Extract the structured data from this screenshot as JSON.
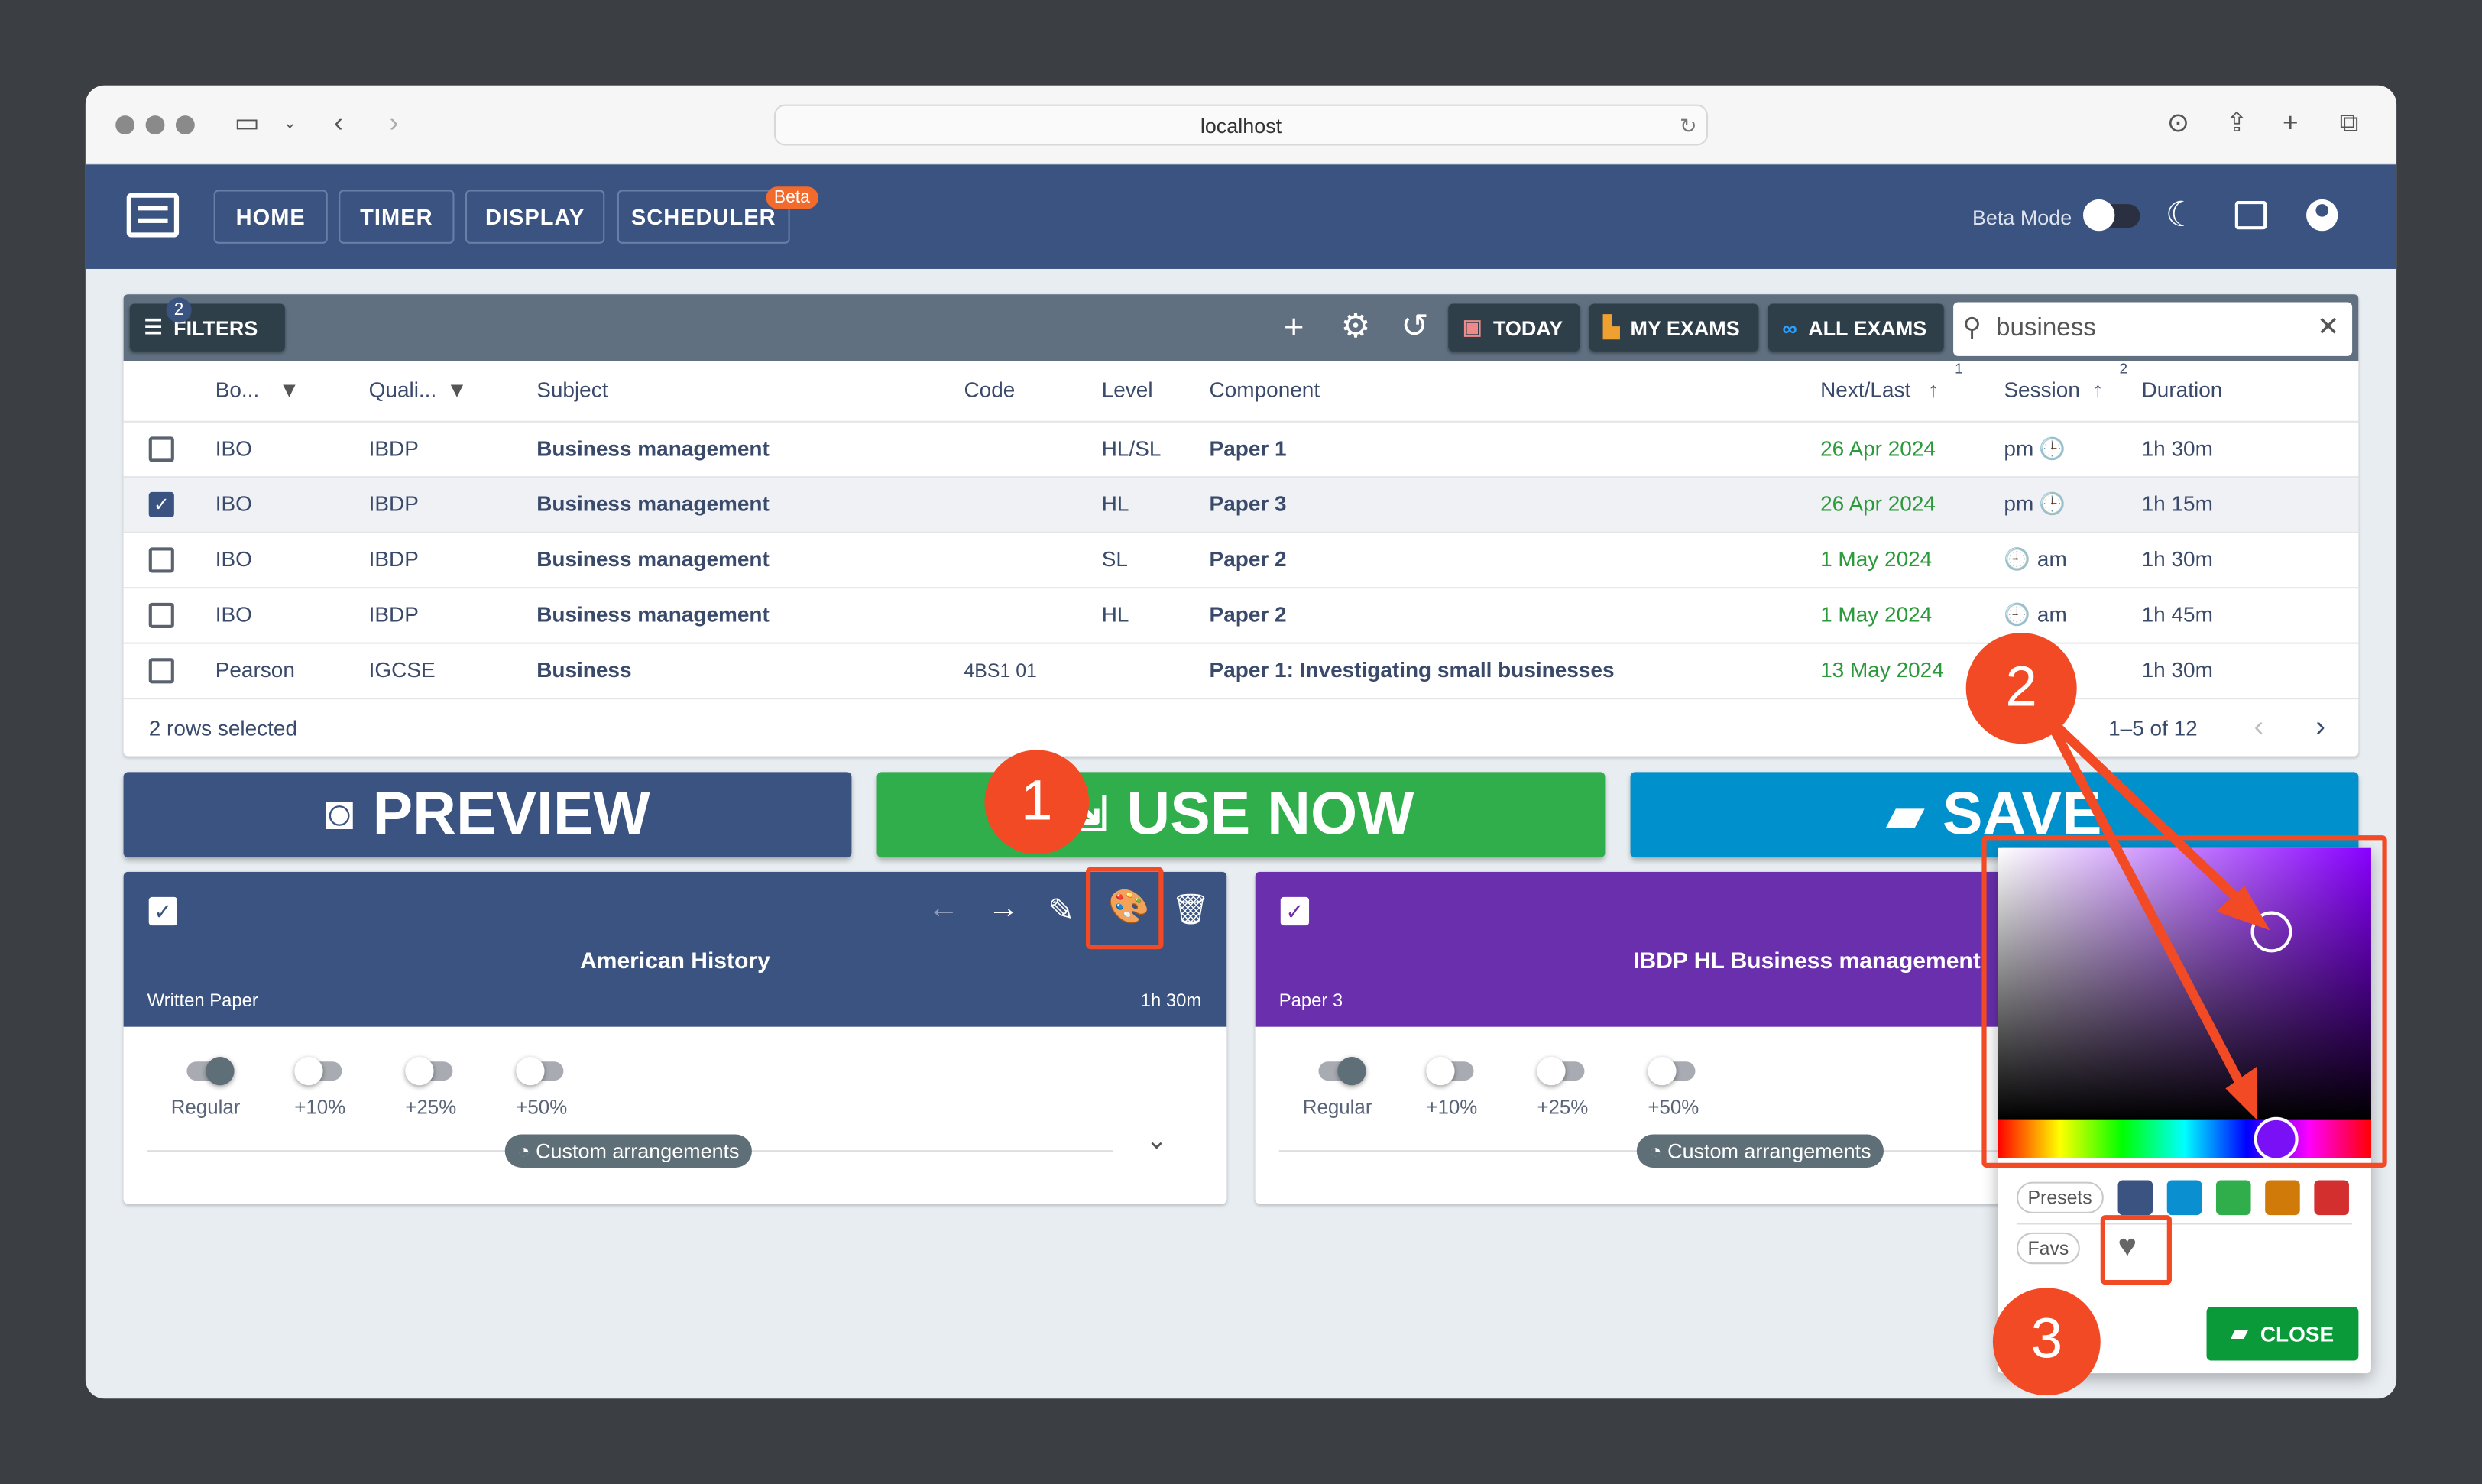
{
  "browser": {
    "url": "localhost"
  },
  "nav": {
    "items": [
      "HOME",
      "TIMER",
      "DISPLAY",
      "SCHEDULER"
    ],
    "beta_badge": "Beta",
    "beta_mode_label": "Beta Mode",
    "beta_mode_on": false
  },
  "toolbar": {
    "filters_label": "FILTERS",
    "filters_count": "2",
    "today": "TODAY",
    "my_exams": "MY EXAMS",
    "all_exams": "ALL EXAMS",
    "search_value": "business"
  },
  "table": {
    "columns": [
      "Bo...",
      "Quali...",
      "Subject",
      "Code",
      "Level",
      "Component",
      "Next/Last",
      "Session",
      "Duration"
    ],
    "sort_indices": {
      "next_last": "1",
      "session": "2"
    },
    "rows": [
      {
        "checked": false,
        "board": "IBO",
        "qual": "IBDP",
        "subject": "Business management",
        "code": "",
        "level": "HL/SL",
        "component": "Paper 1",
        "date": "26 Apr 2024",
        "session": "pm",
        "duration": "1h 30m"
      },
      {
        "checked": true,
        "board": "IBO",
        "qual": "IBDP",
        "subject": "Business management",
        "code": "",
        "level": "HL",
        "component": "Paper 3",
        "date": "26 Apr 2024",
        "session": "pm",
        "duration": "1h 15m"
      },
      {
        "checked": false,
        "board": "IBO",
        "qual": "IBDP",
        "subject": "Business management",
        "code": "",
        "level": "SL",
        "component": "Paper 2",
        "date": "1 May 2024",
        "session": "am",
        "duration": "1h 30m"
      },
      {
        "checked": false,
        "board": "IBO",
        "qual": "IBDP",
        "subject": "Business management",
        "code": "",
        "level": "HL",
        "component": "Paper 2",
        "date": "1 May 2024",
        "session": "am",
        "duration": "1h 45m"
      },
      {
        "checked": false,
        "board": "Pearson",
        "qual": "IGCSE",
        "subject": "Business",
        "code": "4BS1 01",
        "level": "",
        "component": "Paper 1: Investigating small businesses",
        "date": "13 May 2024",
        "session": "",
        "duration": "1h 30m"
      }
    ],
    "selected_text": "2 rows selected",
    "pagination": "1–5 of 12"
  },
  "actions": {
    "preview": "PREVIEW",
    "use_now": "USE NOW",
    "save": "SAVE"
  },
  "exam_cards": [
    {
      "title": "American History",
      "subtitle": "Written Paper",
      "duration": "1h 30m",
      "color": "#3a5380"
    },
    {
      "title": "IBDP HL Business management",
      "subtitle": "Paper 3",
      "duration": "",
      "color": "#6a2fad"
    }
  ],
  "extra_time": {
    "options": [
      "Regular",
      "+10%",
      "+25%",
      "+50%"
    ],
    "selected": "Regular",
    "custom_label": "Custom arrangements"
  },
  "color_picker": {
    "hue_degrees": 272,
    "presets_label": "Presets",
    "presets": [
      "#3a5380",
      "#0a90d0",
      "#2fae4b",
      "#d07a0a",
      "#d32f2f"
    ],
    "favs_label": "Favs",
    "close_label": "CLOSE"
  },
  "annotations": {
    "markers": [
      "1",
      "2",
      "3"
    ],
    "color": "#f24a25"
  }
}
